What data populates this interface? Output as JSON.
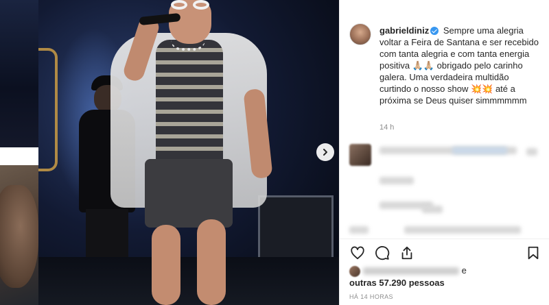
{
  "post": {
    "username": "gabrieldiniz",
    "caption_text": "Sempre uma alegria voltar a Feira de Santana e ser recebido com tanta alegria e com tanta energia positiva 🙏🏼🙏🏼 obrigado pelo carinho galera. Uma verdadeira multidão curtindo o nosso show 💥💥 até a próxima se Deus quiser simmmmmm",
    "time_ago": "14 h",
    "likes_conjunction": "e",
    "likes_others": "outras 57.290 pessoas",
    "timestamp": "HÁ 14 HORAS"
  },
  "colors": {
    "verified_badge": "#3897f0",
    "meta_text": "#8e8e8e",
    "primary_text": "#262626"
  },
  "icons": {
    "carousel_next": "chevron-right-icon",
    "like": "heart-icon",
    "comment": "comment-bubble-icon",
    "share": "share-icon",
    "save": "bookmark-icon",
    "verified": "verified-badge-icon"
  }
}
